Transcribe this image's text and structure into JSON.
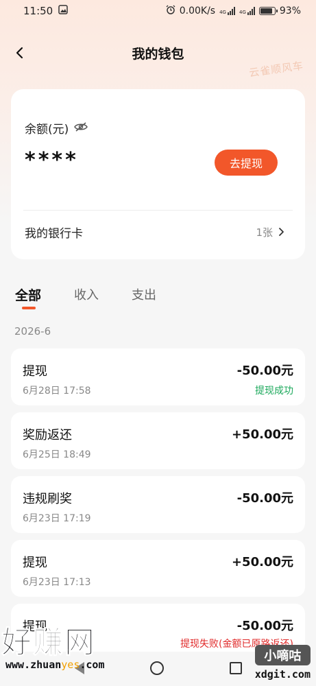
{
  "status_bar": {
    "time": "11:50",
    "network_speed": "0.00K/s",
    "signal_1": "4G",
    "signal_2": "4G",
    "battery": "93%"
  },
  "nav": {
    "title": "我的钱包",
    "brand_watermark": "云雀顺风车"
  },
  "balance": {
    "label": "余额(元)",
    "value": "****",
    "withdraw_label": "去提现"
  },
  "bank": {
    "label": "我的银行卡",
    "count": "1张"
  },
  "tabs": [
    {
      "label": "全部",
      "active": true
    },
    {
      "label": "收入",
      "active": false
    },
    {
      "label": "支出",
      "active": false
    }
  ],
  "month": "2026-6",
  "transactions": [
    {
      "title": "提现",
      "time": "6月28日 17:58",
      "amount": "-50.00元",
      "status": "提现成功",
      "status_color": "#1aa85a"
    },
    {
      "title": "奖励返还",
      "time": "6月25日 18:49",
      "amount": "+50.00元",
      "status": "",
      "status_color": ""
    },
    {
      "title": "违规刷奖",
      "time": "6月23日 17:19",
      "amount": "-50.00元",
      "status": "",
      "status_color": ""
    },
    {
      "title": "提现",
      "time": "6月23日 17:13",
      "amount": "+50.00元",
      "status": "",
      "status_color": ""
    },
    {
      "title": "提现",
      "time": "",
      "amount": "-50.00元",
      "status": "提现失败(金额已原路返还)",
      "status_color": "#e02828"
    }
  ],
  "watermarks": {
    "left_big": "好赚网",
    "left_url_pre": "www.zhuan",
    "left_url_mid": "yes",
    "left_url_post": ".com",
    "right_box": "小嘀咕",
    "right_url": "xdgit.com"
  },
  "colors": {
    "accent": "#f2572a",
    "success": "#1aa85a",
    "failure": "#e02828"
  }
}
